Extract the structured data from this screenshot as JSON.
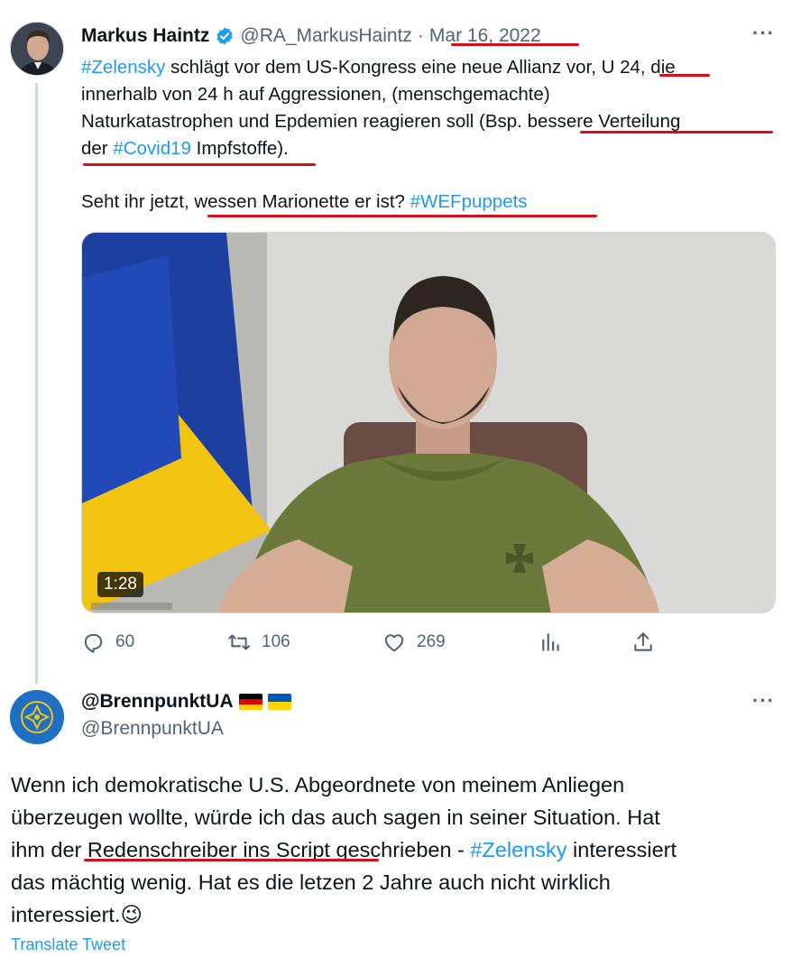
{
  "tweet1": {
    "author_name": "Markus Haintz",
    "handle": "@RA_MarkusHaintz",
    "separator": "·",
    "date": "Mar 16, 2022",
    "more": "···",
    "text": {
      "l1_tag": "#Zelensky",
      "l1_a": " schlägt vor dem US-Kongress eine neue Allianz vor, ",
      "l1_u": "U 24",
      "l1_b": ", die",
      "l2": "innerhalb von 24 h auf Aggressionen, (menschgemachte)",
      "l3_a": "Naturkatastrophen und Epdemien reagieren soll (Bsp. ",
      "l3_b": "bessere Verteilung",
      "l4_a": "der ",
      "l4_tag": "#Covid19",
      "l4_b": " Impfstoffe).",
      "p2_a": "Seht ihr jetzt, ",
      "p2_b": "wessen Marionette er ist? ",
      "p2_tag": "#WEFpuppets"
    },
    "video_duration": "1:28",
    "stats": {
      "replies": "60",
      "retweets": "106",
      "likes": "269"
    }
  },
  "tweet2": {
    "author_name": "@BrennpunktUA",
    "handle": "@BrennpunktUA",
    "more": "···",
    "text": {
      "l1": "Wenn ich demokratische U.S. Abgeordnete von meinem Anliegen",
      "l2": "überzeugen wollte, würde ich das auch sagen in seiner Situation. Hat",
      "l3_a": "ihm der ",
      "l3_u": "Redenschreiber ins Script",
      "l3_b": " geschrieben - ",
      "l3_tag": "#Zelensky",
      "l3_c": " interessiert",
      "l4": "das mächtig wenig. Hat es die letzen 2 Jahre auch nicht wirklich",
      "l5": "interessiert.",
      "emoji": "😉"
    },
    "translate_label": "Translate Tweet"
  },
  "colors": {
    "accent": "#1d9bf0",
    "muted": "#536471",
    "annotation_red": "#d4101a"
  }
}
